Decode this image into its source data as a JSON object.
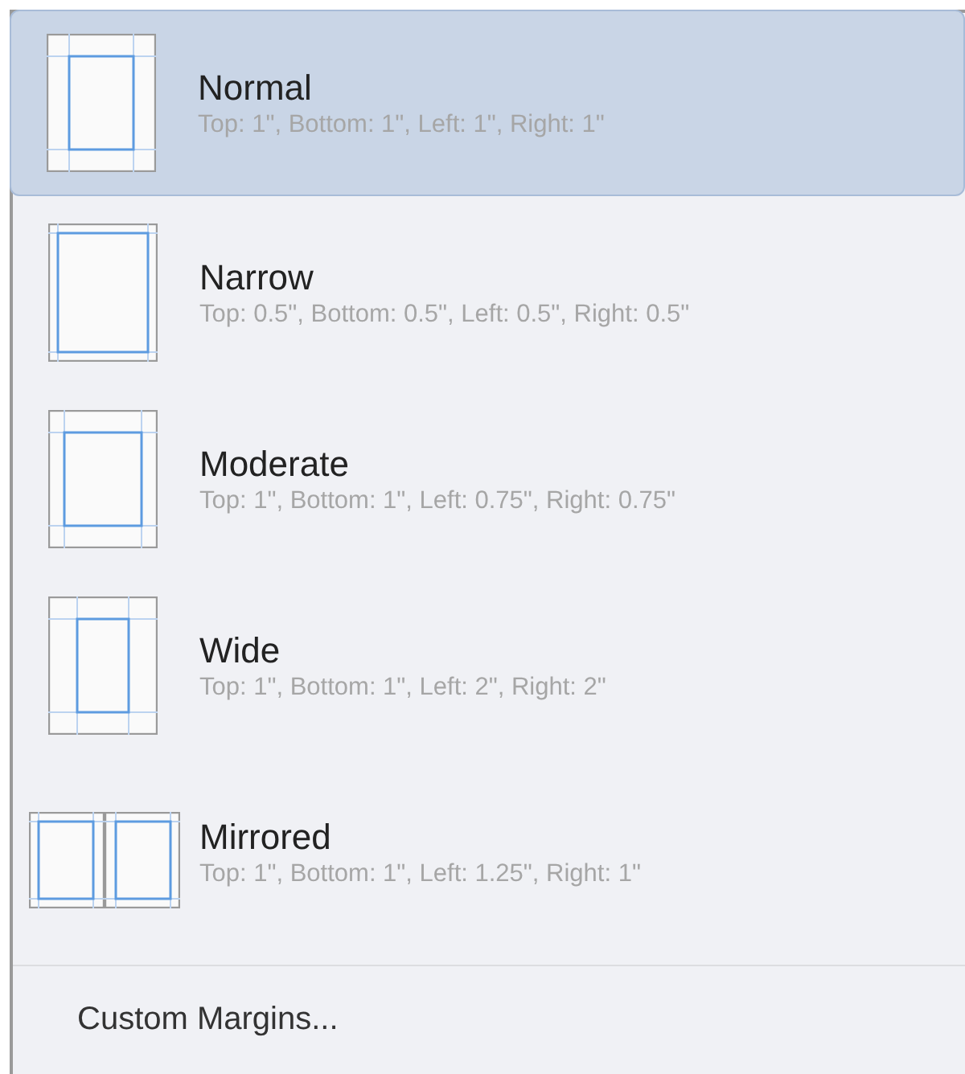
{
  "options": [
    {
      "kind": "normal",
      "title": "Normal",
      "detail": "Top: 1\", Bottom: 1\", Left: 1\", Right: 1\"",
      "selected": true
    },
    {
      "kind": "narrow",
      "title": "Narrow",
      "detail": "Top: 0.5\", Bottom: 0.5\", Left: 0.5\", Right: 0.5\"",
      "selected": false
    },
    {
      "kind": "moderate",
      "title": "Moderate",
      "detail": "Top: 1\", Bottom: 1\", Left: 0.75\", Right: 0.75\"",
      "selected": false
    },
    {
      "kind": "wide",
      "title": "Wide",
      "detail": "Top: 1\", Bottom: 1\", Left: 2\", Right: 2\"",
      "selected": false
    },
    {
      "kind": "mirrored",
      "title": "Mirrored",
      "detail": "Top: 1\", Bottom: 1\", Left: 1.25\", Right: 1\"",
      "selected": false
    }
  ],
  "custom": {
    "label": "Custom Margins..."
  }
}
